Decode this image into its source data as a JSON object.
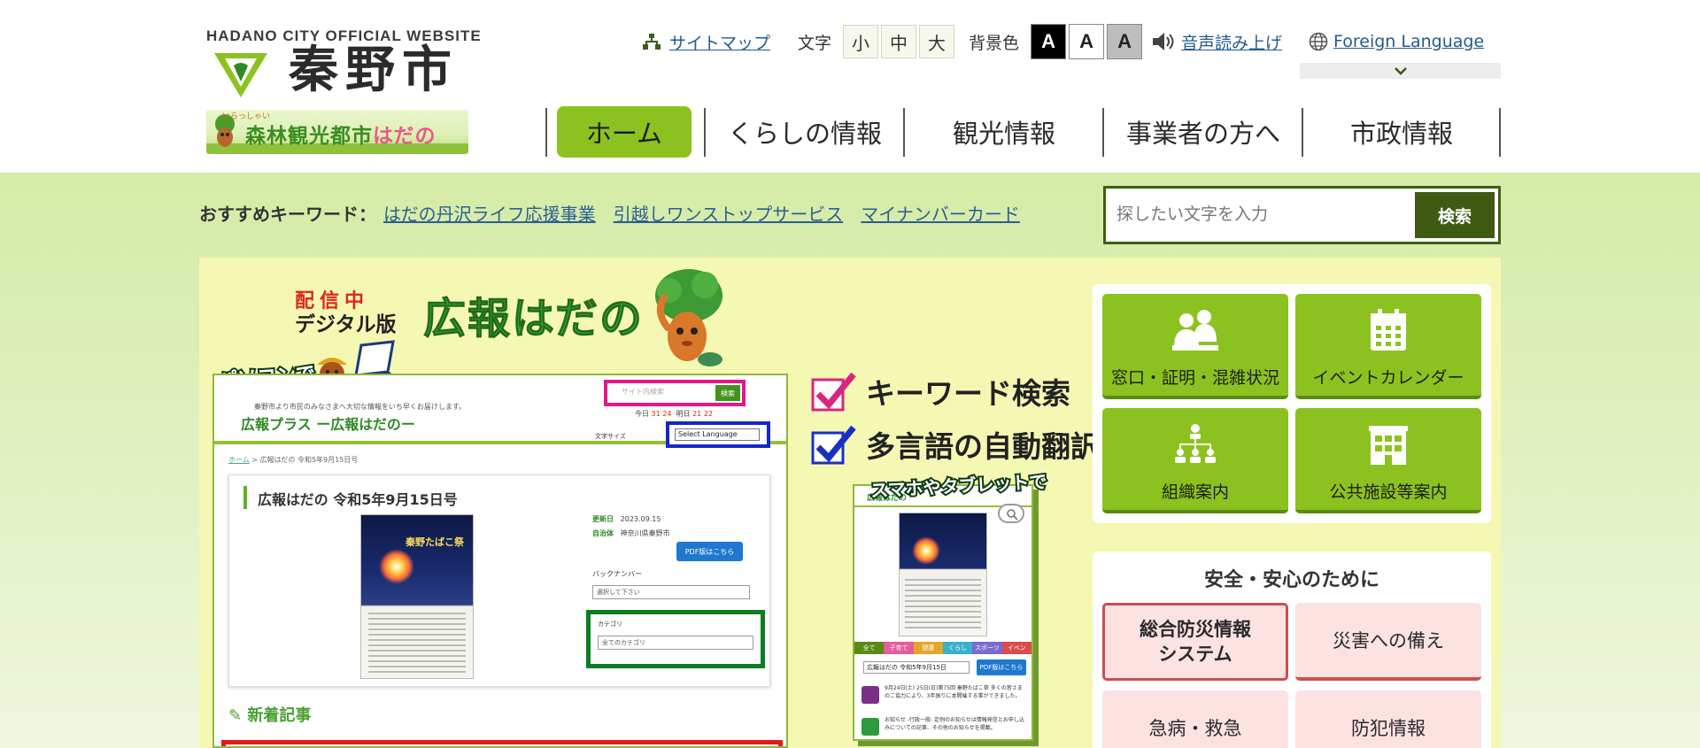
{
  "header": {
    "site_en": "HADANO CITY OFFICIAL WEBSITE",
    "city_name": "秦野市",
    "forest_banner": {
      "small": "いらっしゃい",
      "text_a": "森林観光都市",
      "text_b": "はだの"
    },
    "utility": {
      "sitemap": "サイトマップ",
      "font_size_label": "文字",
      "font_sizes": [
        "小",
        "中",
        "大"
      ],
      "bg_label": "背景色",
      "bg_options": [
        "A",
        "A",
        "A"
      ],
      "read_aloud": "音声読み上げ",
      "foreign_language": "Foreign Language"
    },
    "nav": [
      "ホーム",
      "くらしの情報",
      "観光情報",
      "事業者の方へ",
      "市政情報"
    ]
  },
  "keywords": {
    "label": "おすすめキーワード：",
    "items": [
      "はだの丹沢ライフ応援事業",
      "引越しワンストップサービス",
      "マイナンバーカード"
    ]
  },
  "search": {
    "placeholder": "探したい文字を入力",
    "button": "検索"
  },
  "promo": {
    "haishin": "配信中",
    "digital": "デジタル版",
    "title": "広報はだの",
    "pc_tag": "パソコンで",
    "sp_tag": "スマホやタブレットで",
    "features": [
      "キーワード検索",
      "多言語の自動翻訳"
    ],
    "pc": {
      "intro": "秦野市より市民のみなさまへ大切な情報をいち早くお届けします。",
      "logo": "広報プラス ー広報はだのー",
      "search_placeholder": "サイト内検索",
      "search_btn": "検索",
      "date_today": "今日",
      "date_today_val": "31 24",
      "date_tomorrow": "明日",
      "date_tomorrow_val": "21 22",
      "font_size": "文字サイズ",
      "language": "Select Language",
      "crumb_home": "ホーム",
      "crumb_current": "広報はだの 令和5年9月15日号",
      "issue": "広報はだの 令和5年9月15日号",
      "cover_title": "秦野たばこ祭",
      "meta_updated_label": "更新日",
      "meta_updated": "2023.09.15",
      "meta_org_label": "自治体",
      "meta_org": "神奈川県秦野市",
      "pdf": "PDF版はこちら",
      "backnumber": "バックナンバー",
      "backnumber_select": "選択して下さい",
      "category": "カテゴリ",
      "category_select": "全てのカテゴリ",
      "new_articles": "新着記事"
    },
    "sp": {
      "logo": "広報はだの",
      "tabs": [
        "全て",
        "子育て",
        "健康",
        "くらし",
        "スポーツ",
        "イベン"
      ],
      "issue": "広報はだの 令和5年9月15日",
      "pdf": "PDF版はこちら",
      "item1": "9月24日(土) 25日(日)第75回 秦野たばこ祭 多くの皆さまのご協力により、3年振りに本開催する事ができました。",
      "item2": "お知らせ -行政一般- 定例のお知らせは情報発信とお申し込みについての記事、その他のお知らせを掲載。"
    }
  },
  "quick_links": [
    "窓口・証明・混雑状況",
    "イベントカレンダー",
    "組織案内",
    "公共施設等案内"
  ],
  "safety": {
    "title": "安全・安心のために",
    "items": [
      "総合防災情報\nシステム",
      "災害への備え",
      "急病・救急",
      "防犯情報"
    ]
  },
  "colors": {
    "accent_green": "#8cc21f",
    "dark_green": "#3f5a12",
    "band": "#d5eba6",
    "promo_bg": "#f5f8b3",
    "link": "#235b8f",
    "safety_pink": "#fde2e2",
    "safety_red": "#c9504f"
  },
  "icons": {
    "sitemap": "sitemap-icon",
    "read_aloud": "speaker-icon",
    "foreign_language": "globe-icon",
    "lang_toggle": "chevron-down-icon",
    "quick": [
      "people-icon",
      "calendar-icon",
      "org-chart-icon",
      "building-icon"
    ]
  }
}
